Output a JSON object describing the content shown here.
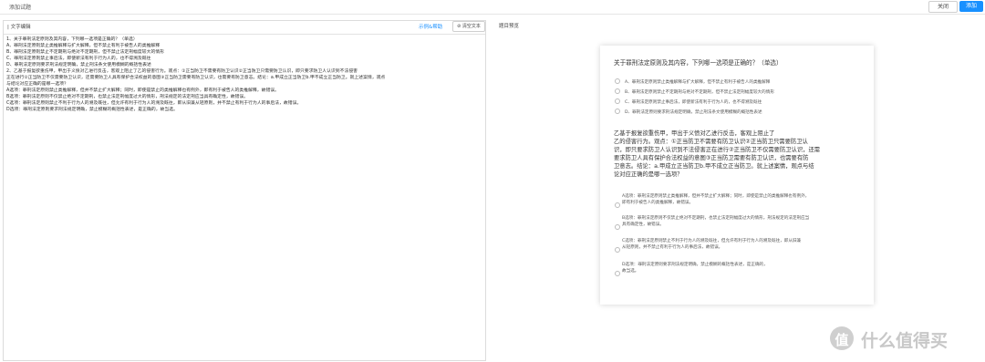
{
  "header": {
    "title": "添加试题",
    "close_label": "关闭",
    "add_label": "添加"
  },
  "left": {
    "label": "| 文字编辑",
    "example_link": "示例&帮助",
    "clear_label": "⊘ 清空文本",
    "lines": [
      "1、关于罪刑法定原则及其内容，下列哪一选项是正确的？（单选）",
      "A、罪刑法定原则禁止类推解释与扩大解释，但不禁止有利于被告人的类推解释",
      "B、罪刑法定原则禁止不定期刑与绝对不定期刑，但不禁止法定刑幅度较大的情形",
      "C、罪刑法定原则禁止事后法，即使新法有利于行为人的，也不得溯及既往",
      "D、罪刑法定原则要求刑法规定明确，禁止刑法条文使用模糊的概括性表述",
      "2、乙基于报复欲重伤甲，甲出于义愤对乙进行反击，客观上阻止了乙的侵害行为。观点：①正当防卫不需要有防卫认识②正当防卫只需要防卫认识，即只要求防卫人认识到不法侵害",
      "正在进行②正当防卫不仅需要防卫认识，还需要防卫人具有保护合法权益的意图③正当防卫需要有防卫认识，也需要有防卫意志。结论：a.甲成立正当防卫b.甲不成立正当防卫。就上述案情，观点",
      "与结论对应正确的是哪一选项？",
      "A选项：罪刑法定原则禁止类推解释，但并不禁止扩大解释；同时，即使是禁止的类推解释也有例外，即有利于被告人的类推解释，故错误。",
      "B选项：罪刑法定原则不仅禁止绝对不定期刑，也禁止法定刑幅度过大的情形，刑法规定的法定刑应当具有确定性，故错误。",
      "C选项：罪刑法定原则禁止不利于行为人的溯及既往，但允许有利于行为人的溯及既往，即从旧兼从轻原则，并不禁止有利于行为人的事后法，故错误。",
      "D选项：罪刑法定原则要求刑法规定明确，禁止模糊的概括性表述，是正确的，故当选。"
    ]
  },
  "right": {
    "label": "题目预览",
    "q1": {
      "stem": "关于罪刑法定原则及其内容，下列哪一选项是正确的？（单选）",
      "options": [
        "A、罪刑法定原则禁止类推解释与扩大解释，但不禁止有利于被告人的类推解释",
        "B、罪刑法定原则禁止不定期刑与绝对不定期刑，但不禁止法定刑幅度较大的情形",
        "C、罪刑法定原则禁止事后法，即使新法有利于行为人的，也不得溯及既往",
        "D、罪刑法定原则要求刑法规定明确，禁止刑法条文使用模糊的概括性表述"
      ]
    },
    "q2": {
      "stem_lines": [
        "乙基于报复欲重伤甲，甲出于义愤对乙进行反击，客观上阻止了",
        "乙的侵害行为。观点：①正当防卫不需要有防卫认识②正当防卫只需要防卫认",
        "识，即只要求防卫人认识到不法侵害正在进行②正当防卫不仅需要防卫认识，还需",
        "要求防卫人具有保护合法权益的意图③正当防卫需要有防卫认识，也需要有防",
        "卫意志。结论：a.甲成立正当防卫b.甲不成立正当防卫。就上述案情，观点与结",
        "论对应正确的是哪一选项？"
      ],
      "options": [
        [
          "A选项：罪刑法定原则禁止类推解释，但并不禁止扩大解释；同时，即使是禁止的类推解释也有例外，",
          "即有利于被告人的类推解释，故错误。"
        ],
        [
          "B选项：罪刑法定原则不仅禁止绝对不定期刑，也禁止法定刑幅度过大的情形，刑法规定的法定刑应当",
          "具有确定性，故错误。"
        ],
        [
          "C选项：罪刑法定原则禁止不利于行为人的溯及既往，但允许有利于行为人的溯及既往，即从旧兼",
          "从轻原则，并不禁止有利于行为人的事后法，故错误。"
        ],
        [
          "D选项：罪刑法定原则要求刑法规定明确，禁止模糊的概括性表述，是正确的，",
          "故当选。"
        ]
      ]
    }
  },
  "watermark": {
    "icon_glyph": "值",
    "text": "什么值得买"
  },
  "colors": {
    "primary": "#1890ff",
    "border": "#dcdcdc",
    "text": "#333333"
  }
}
